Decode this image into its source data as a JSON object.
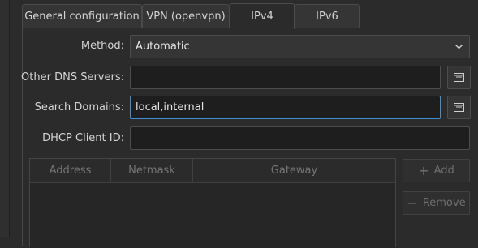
{
  "tabs": [
    {
      "label": "General configuration",
      "active": false
    },
    {
      "label": "VPN (openvpn)",
      "active": false
    },
    {
      "label": "IPv4",
      "active": true
    },
    {
      "label": "IPv6",
      "active": false
    }
  ],
  "form": {
    "method": {
      "label": "Method:",
      "value": "Automatic"
    },
    "dns": {
      "label": "Other DNS Servers:",
      "value": ""
    },
    "search": {
      "label": "Search Domains:",
      "value": "local,internal"
    },
    "dhcp": {
      "label": "DHCP Client ID:",
      "value": ""
    }
  },
  "table": {
    "columns": [
      "Address",
      "Netmask",
      "Gateway"
    ],
    "rows": []
  },
  "buttons": {
    "add": {
      "icon": "+",
      "label": "Add"
    },
    "remove": {
      "icon": "−",
      "label": "Remove"
    }
  },
  "colors": {
    "accent": "#3d8fd6"
  }
}
